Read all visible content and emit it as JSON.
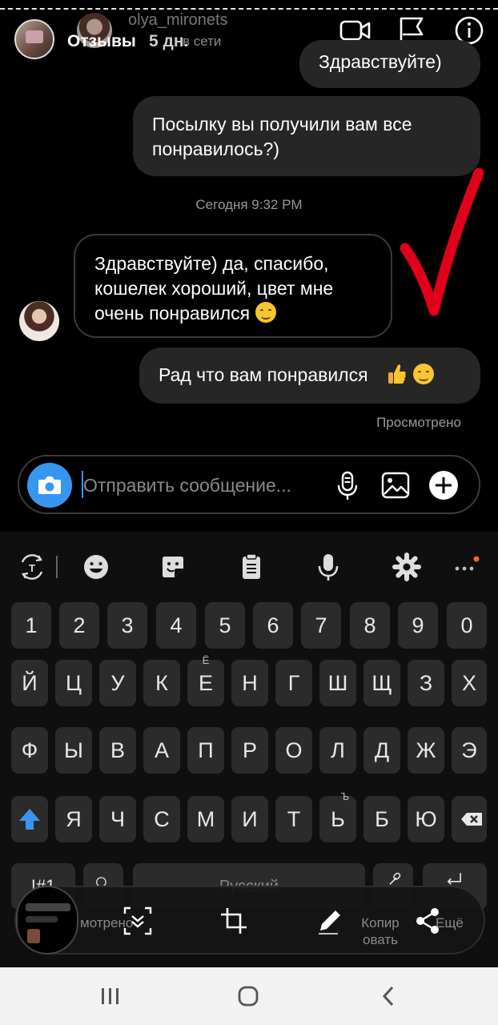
{
  "story_header": {
    "title": "Отзывы",
    "time": "5 дн."
  },
  "chat_header": {
    "username": "olya_mironets",
    "status": "в сети"
  },
  "messages": [
    {
      "direction": "outgoing",
      "text": "Здравствуйте)"
    },
    {
      "direction": "outgoing",
      "text": "Посылку вы получили вам все понравилось?)"
    },
    {
      "direction": "incoming",
      "text": "Здравствуйте) да, спасибо, кошелек хороший, цвет мне очень понравился"
    },
    {
      "direction": "outgoing",
      "text": "Рад что вам понравился"
    }
  ],
  "timestamp": "Сегодня 9:32 PM",
  "seen_label": "Просмотрено",
  "composer": {
    "placeholder": "Отправить сообщение..."
  },
  "keyboard": {
    "rows": [
      [
        "1",
        "2",
        "3",
        "4",
        "5",
        "6",
        "7",
        "8",
        "9",
        "0"
      ],
      [
        "Й",
        "Ц",
        "У",
        "К",
        "Е",
        "Н",
        "Г",
        "Ш",
        "Щ",
        "З",
        "Х"
      ],
      [
        "Ф",
        "Ы",
        "В",
        "А",
        "П",
        "Р",
        "О",
        "Л",
        "Д",
        "Ж",
        "Э"
      ],
      [
        "Я",
        "Ч",
        "С",
        "М",
        "И",
        "Т",
        "Ь",
        "Б",
        "Ю"
      ]
    ],
    "alt_e": "Ё",
    "alt_soft": "Ъ",
    "symbols_key": "!#1",
    "comma": ",",
    "space_label": "Русский"
  },
  "screenshot_toolbar": {
    "left_label": "мотрено",
    "copy_label_line1": "Копир",
    "copy_label_line2": "овать",
    "more_label": "Ещё"
  },
  "colors": {
    "accent_blue": "#3797f0",
    "bubble_outgoing": "#262626",
    "checkmark_red": "#e0001a"
  }
}
